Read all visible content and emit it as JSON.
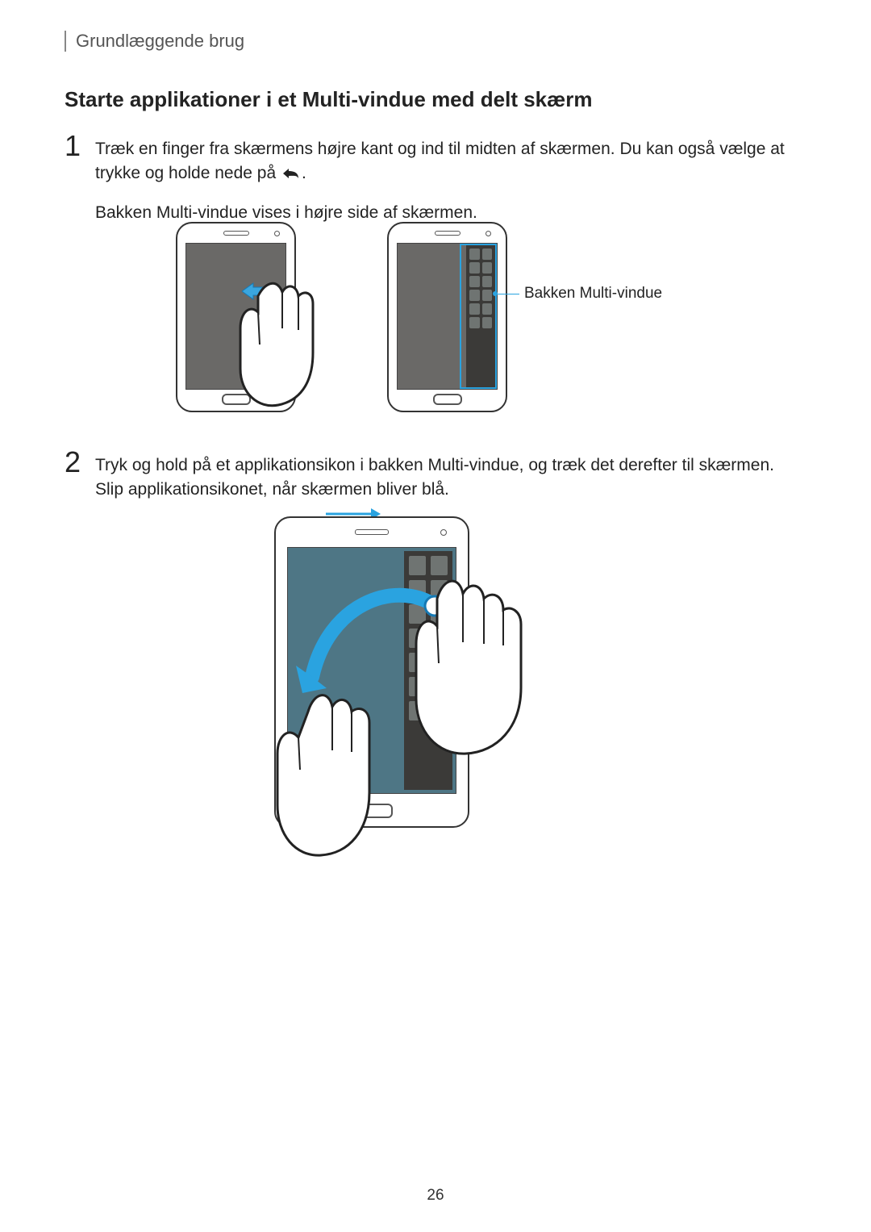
{
  "running_head": "Grundlæggende brug",
  "heading": "Starte applikationer i et Multi-vindue med delt skærm",
  "steps": {
    "s1": {
      "num": "1",
      "line1a": "Træk en finger fra skærmens højre kant og ind til midten af skærmen. Du kan også vælge at trykke og holde nede på ",
      "line1b": ".",
      "line2": "Bakken Multi-vindue vises i højre side af skærmen."
    },
    "s2": {
      "num": "2",
      "line1": "Tryk og hold på et applikationsikon i bakken Multi-vindue, og træk det derefter til skærmen. Slip applikationsikonet, når skærmen bliver blå."
    }
  },
  "callout": {
    "tray_label": "Bakken Multi-vindue"
  },
  "page_number": "26"
}
